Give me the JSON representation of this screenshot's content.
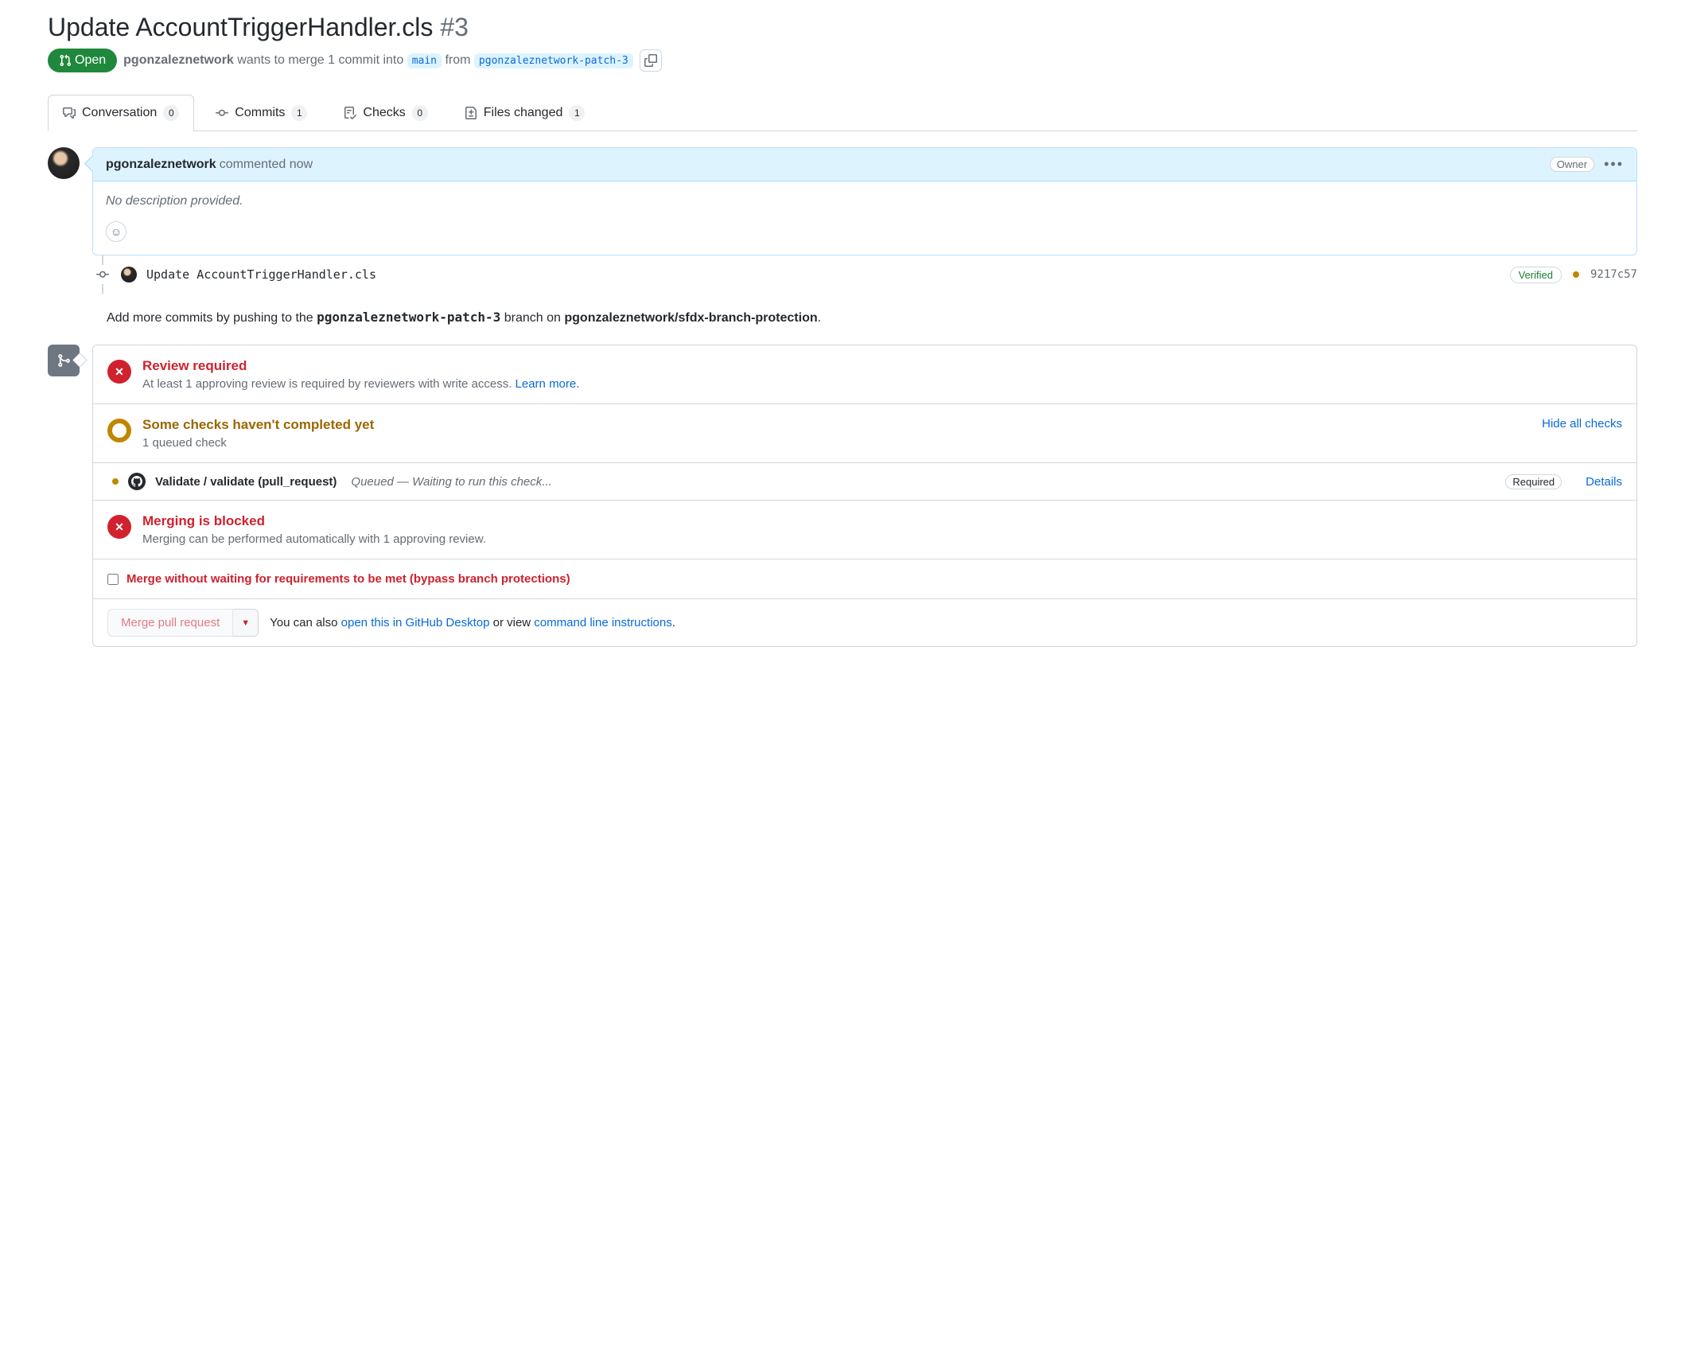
{
  "title": "Update AccountTriggerHandler.cls",
  "pr_number": "#3",
  "state_label": "Open",
  "meta": {
    "author": "pgonzaleznetwork",
    "text1": "wants to merge 1 commit into",
    "base_branch": "main",
    "text2": "from",
    "head_branch": "pgonzaleznetwork-patch-3"
  },
  "tabs": {
    "conversation": {
      "label": "Conversation",
      "count": "0"
    },
    "commits": {
      "label": "Commits",
      "count": "1"
    },
    "checks": {
      "label": "Checks",
      "count": "0"
    },
    "files": {
      "label": "Files changed",
      "count": "1"
    }
  },
  "comment": {
    "author": "pgonzaleznetwork",
    "when": "commented now",
    "role_badge": "Owner",
    "body": "No description provided."
  },
  "commit": {
    "message": "Update AccountTriggerHandler.cls",
    "verified": "Verified",
    "sha": "9217c57"
  },
  "hint": {
    "prefix": "Add more commits by pushing to the ",
    "branch": "pgonzaleznetwork-patch-3",
    "mid": " branch on ",
    "repo": "pgonzaleznetwork/sfdx-branch-protection",
    "suffix": "."
  },
  "merge": {
    "review": {
      "title": "Review required",
      "sub": "At least 1 approving review is required by reviewers with write access. ",
      "learn": "Learn more."
    },
    "checks": {
      "title": "Some checks haven't completed yet",
      "sub": "1 queued check",
      "toggle": "Hide all checks"
    },
    "check_item": {
      "name": "Validate / validate (pull_request)",
      "status": "Queued — Waiting to run this check...",
      "required": "Required",
      "details": "Details"
    },
    "blocked": {
      "title": "Merging is blocked",
      "sub": "Merging can be performed automatically with 1 approving review."
    },
    "bypass": "Merge without waiting for requirements to be met (bypass branch protections)",
    "merge_btn": "Merge pull request",
    "alt": {
      "prefix": "You can also ",
      "desktop": "open this in GitHub Desktop",
      "mid": " or view ",
      "cli": "command line instructions",
      "suffix": "."
    }
  }
}
